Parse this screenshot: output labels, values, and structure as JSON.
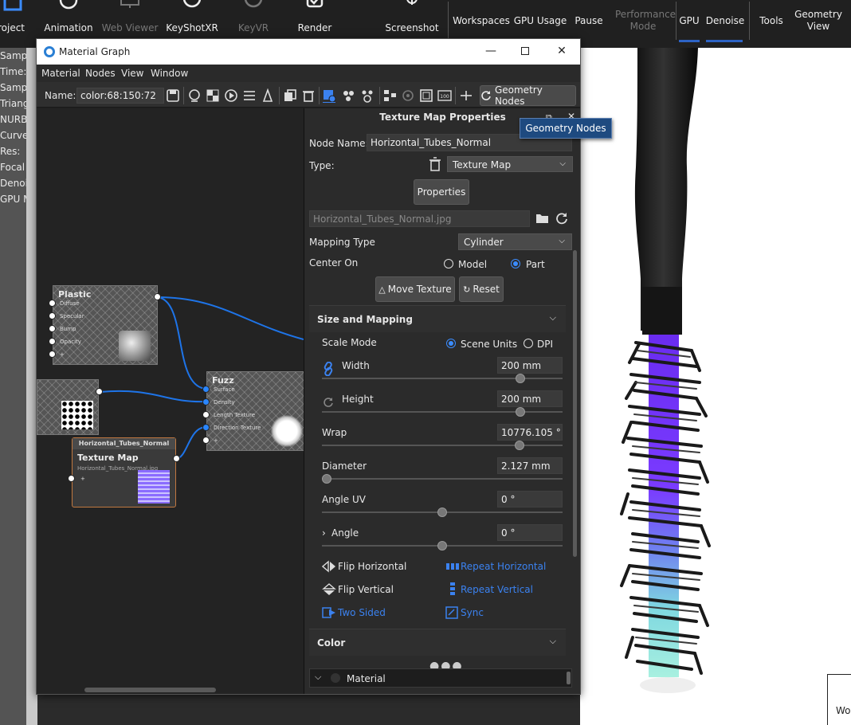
{
  "topbar": {
    "items": [
      {
        "label": "roject"
      },
      {
        "label": "Animation"
      },
      {
        "label": "Web Viewer"
      },
      {
        "label": "KeyShotXR"
      },
      {
        "label": "KeyVR"
      },
      {
        "label": "Render"
      },
      {
        "label": "Screenshot"
      }
    ],
    "right_items": [
      {
        "label": "Workspaces"
      },
      {
        "label": "GPU Usage"
      },
      {
        "label": "Pause"
      },
      {
        "label": "Performance Mode"
      },
      {
        "label": "GPU"
      },
      {
        "label": "Denoise"
      },
      {
        "label": "Tools"
      },
      {
        "label": "Geometry View"
      }
    ]
  },
  "left_stats": [
    "Samples",
    "Time:",
    "Samples",
    "Triangle",
    "NURBS:",
    "Curves:",
    "Res:",
    "Focal Le",
    "Denoise",
    "GPU Me"
  ],
  "window": {
    "title": "Material Graph",
    "menu": [
      "Material",
      "Nodes",
      "View",
      "Window"
    ],
    "name_label": "Name:",
    "name_value": "color:68:150:72",
    "geometry_nodes_button": "Geometry Nodes"
  },
  "tooltip": "Geometry Nodes",
  "graph": {
    "plastic": {
      "title": "Plastic",
      "pins": [
        "Diffuse",
        "Specular",
        "Bump",
        "Opacity",
        "+"
      ]
    },
    "fuzz": {
      "title": "Fuzz",
      "pins": [
        "Surface",
        "Density",
        "Length Texture",
        "Direction Texture",
        "+"
      ]
    },
    "texture_map": {
      "header": "Horizontal_Tubes_Normal",
      "title": "Texture Map",
      "filename": "Horizontal_Tubes_Normal.jpg",
      "pin": "+"
    }
  },
  "props": {
    "header": "Texture Map Properties",
    "node_name_label": "Node Name:",
    "node_name_value": "Horizontal_Tubes_Normal",
    "type_label": "Type:",
    "type_value": "Texture Map",
    "properties_button": "Properties",
    "file_value": "Horizontal_Tubes_Normal.jpg",
    "mapping_type_label": "Mapping Type",
    "mapping_type_value": "Cylinder",
    "center_on_label": "Center On",
    "center_on_options": {
      "model": "Model",
      "part": "Part"
    },
    "center_on_selected": "Part",
    "move_texture": "Move Texture",
    "reset": "Reset",
    "size_section": "Size and Mapping",
    "scale_mode_label": "Scale Mode",
    "scale_mode_options": {
      "scene": "Scene Units",
      "dpi": "DPI"
    },
    "scale_mode_selected": "Scene Units",
    "width_label": "Width",
    "width_value": "200 mm",
    "height_label": "Height",
    "height_value": "200 mm",
    "wrap_label": "Wrap",
    "wrap_value": "10776.105 °",
    "diameter_label": "Diameter",
    "diameter_value": "2.127 mm",
    "angle_uv_label": "Angle UV",
    "angle_uv_value": "0 °",
    "angle_label": "Angle",
    "angle_value": "0 °",
    "sliders": {
      "width": 0.83,
      "height": 0.83,
      "wrap": 0.83,
      "diameter": 0.0,
      "angle_uv": 0.5,
      "angle": 0.5
    },
    "flip_horizontal": "Flip Horizontal",
    "flip_vertical": "Flip Vertical",
    "two_sided": "Two Sided",
    "repeat_horizontal": "Repeat Horizontal",
    "repeat_vertical": "Repeat Vertical",
    "sync": "Sync",
    "color_section": "Color",
    "material_label": "Material"
  },
  "viewport_corner": "Wo"
}
